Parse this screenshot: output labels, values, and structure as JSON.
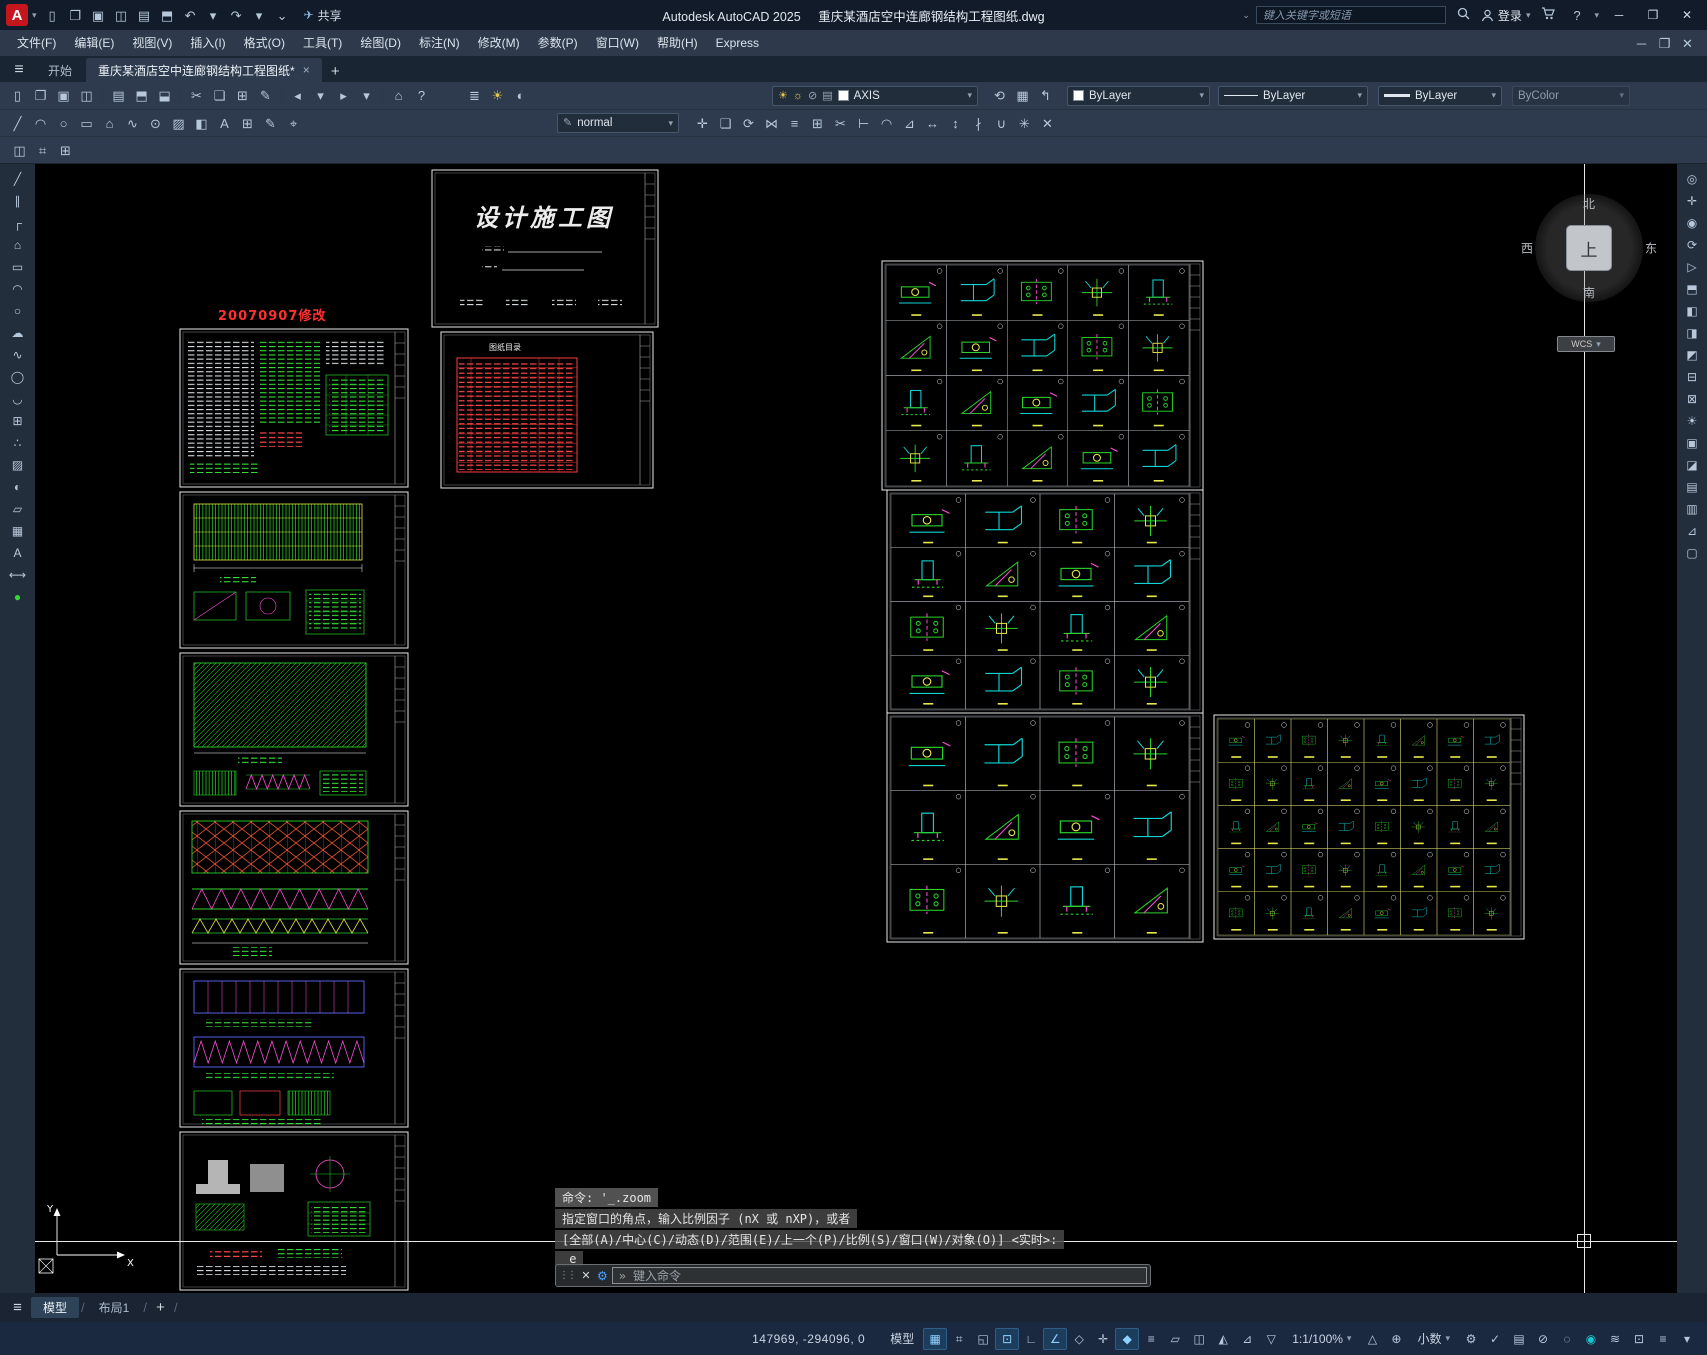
{
  "titlebar": {
    "app": "Autodesk AutoCAD 2025",
    "doc": "重庆某酒店空中连廊钢结构工程图纸.dwg",
    "share": "共享",
    "search_placeholder": "键入关键字或短语",
    "login": "登录"
  },
  "menu": [
    "文件(F)",
    "编辑(E)",
    "视图(V)",
    "插入(I)",
    "格式(O)",
    "工具(T)",
    "绘图(D)",
    "标注(N)",
    "修改(M)",
    "参数(P)",
    "窗口(W)",
    "帮助(H)",
    "Express"
  ],
  "doc_tabs": {
    "start": "开始",
    "drawing": "重庆某酒店空中连廊钢结构工程图纸*"
  },
  "ribbon": {
    "layer": "AXIS",
    "color": "ByLayer",
    "linetype": "ByLayer",
    "lineweight": "ByLayer",
    "plotstyle": "ByColor",
    "textstyle": "normal"
  },
  "canvas": {
    "revision_note": "20070907修改",
    "cover_title": "设计施工图",
    "index_title": "图纸目录"
  },
  "viewcube": {
    "n": "北",
    "s": "南",
    "e": "东",
    "w": "西",
    "top": "上",
    "wcs": "WCS"
  },
  "command": {
    "l1": "命令: '_.zoom",
    "l2": "指定窗口的角点，输入比例因子 (nX 或 nXP)，或者",
    "l3": "[全部(A)/中心(C)/动态(D)/范围(E)/上一个(P)/比例(S)/窗口(W)/对象(O)] <实时>:",
    "l4": "_e",
    "placeholder": "键入命令"
  },
  "layout_tabs": {
    "model": "模型",
    "layout1": "布局1"
  },
  "statusbar": {
    "coords": "147969, -294096, 0",
    "model": "模型",
    "scale": "1:1/100%",
    "units": "小数"
  },
  "colors": {
    "accent": "#4da3ff",
    "cad_green": "#27d227",
    "cad_cyan": "#0fd3d3",
    "cad_magenta": "#ff4fd8",
    "cad_red": "#ff3b3b",
    "cad_yellow": "#e8e84a"
  },
  "icons": {
    "qat": [
      {
        "n": "qnew",
        "g": "▯"
      },
      {
        "n": "open-file",
        "g": "❐"
      },
      {
        "n": "save-file",
        "g": "▣"
      },
      {
        "n": "save-as",
        "g": "◫"
      },
      {
        "n": "plot",
        "g": "▤"
      },
      {
        "n": "print-preview",
        "g": "⬒"
      },
      {
        "n": "undo",
        "g": "↶"
      },
      {
        "n": "undo-menu",
        "g": "▾"
      },
      {
        "n": "redo",
        "g": "↷"
      },
      {
        "n": "redo-menu",
        "g": "▾"
      },
      {
        "n": "customize-qat",
        "g": "⌄"
      }
    ],
    "mwin": [
      {
        "n": "doc-minimize",
        "g": "─"
      },
      {
        "n": "doc-restore",
        "g": "❐"
      },
      {
        "n": "doc-close",
        "g": "✕"
      }
    ],
    "r1a": [
      {
        "n": "qnew",
        "g": "▯"
      },
      {
        "n": "open-file",
        "g": "❐"
      },
      {
        "n": "save-file",
        "g": "▣"
      },
      {
        "n": "save-all",
        "g": "◫"
      },
      {
        "n": "sep"
      },
      {
        "n": "plot",
        "g": "▤"
      },
      {
        "n": "plot-preview",
        "g": "⬒"
      },
      {
        "n": "publish",
        "g": "⬓"
      },
      {
        "n": "sep"
      },
      {
        "n": "cut-clip",
        "g": "✂"
      },
      {
        "n": "copy-clip",
        "g": "❏"
      },
      {
        "n": "paste-clip",
        "g": "⊞"
      },
      {
        "n": "match-properties",
        "g": "✎"
      },
      {
        "n": "sep"
      },
      {
        "n": "undo-large",
        "g": "◂"
      },
      {
        "n": "undo-caret",
        "g": "▾"
      },
      {
        "n": "redo-large",
        "g": "▸"
      },
      {
        "n": "redo-caret",
        "g": "▾"
      },
      {
        "n": "sep"
      },
      {
        "n": "zoom-previous",
        "g": "⌂"
      },
      {
        "n": "help",
        "g": "?"
      }
    ],
    "r1b": [
      {
        "n": "layer-properties",
        "g": "≣"
      },
      {
        "n": "layer-off",
        "g": "☀",
        "c": "gold"
      },
      {
        "n": "layer-isolate",
        "g": "◐"
      }
    ],
    "r1c": [
      {
        "n": "layer-previous",
        "g": "⟲"
      },
      {
        "n": "layer-states",
        "g": "▦"
      },
      {
        "n": "layer-match",
        "g": "↰"
      }
    ],
    "r2a": [
      {
        "n": "line",
        "g": "╱"
      },
      {
        "n": "arc",
        "g": "◠"
      },
      {
        "n": "circle",
        "g": "○"
      },
      {
        "n": "rectangle",
        "g": "▭"
      },
      {
        "n": "polygon",
        "g": "⌂"
      },
      {
        "n": "spline",
        "g": "∿"
      },
      {
        "n": "donut",
        "g": "⊙"
      },
      {
        "n": "hatch",
        "g": "▨"
      },
      {
        "n": "gradient",
        "g": "◧"
      },
      {
        "n": "text",
        "g": "A"
      },
      {
        "n": "table",
        "g": "⊞"
      },
      {
        "n": "edit-text",
        "g": "✎"
      },
      {
        "n": "point",
        "g": "⌖"
      }
    ],
    "r2b": [
      {
        "n": "move",
        "g": "✛"
      },
      {
        "n": "copy",
        "g": "❏"
      },
      {
        "n": "rotate",
        "g": "⟳"
      },
      {
        "n": "mirror",
        "g": "⋈"
      },
      {
        "n": "offset",
        "g": "≡"
      },
      {
        "n": "array",
        "g": "⊞"
      },
      {
        "n": "trim",
        "g": "✂"
      },
      {
        "n": "extend",
        "g": "⊢"
      },
      {
        "n": "fillet",
        "g": "◠"
      },
      {
        "n": "chamfer",
        "g": "⊿"
      },
      {
        "n": "stretch",
        "g": "↔"
      },
      {
        "n": "scale",
        "g": "↕"
      },
      {
        "n": "break",
        "g": "∤"
      },
      {
        "n": "join",
        "g": "∪"
      },
      {
        "n": "explode",
        "g": "✳"
      },
      {
        "n": "erase",
        "g": "✕"
      }
    ],
    "r3": [
      {
        "n": "drawing-compare",
        "g": "◫"
      },
      {
        "n": "measure",
        "g": "⌗"
      },
      {
        "n": "count",
        "g": "⊞"
      }
    ],
    "left": [
      {
        "n": "line",
        "g": "╱"
      },
      {
        "n": "construction-line",
        "g": "∥"
      },
      {
        "n": "polyline",
        "g": "┌"
      },
      {
        "n": "polygon",
        "g": "⌂"
      },
      {
        "n": "rectangle",
        "g": "▭"
      },
      {
        "n": "arc",
        "g": "◠"
      },
      {
        "n": "circle",
        "g": "○"
      },
      {
        "n": "revision-cloud",
        "g": "☁"
      },
      {
        "n": "spline",
        "g": "∿"
      },
      {
        "n": "ellipse",
        "g": "◯"
      },
      {
        "n": "ellipse-arc",
        "g": "◡"
      },
      {
        "n": "insert-block",
        "g": "⊞"
      },
      {
        "n": "point",
        "g": "∴"
      },
      {
        "n": "hatch",
        "g": "▨"
      },
      {
        "n": "gradient",
        "g": "◐"
      },
      {
        "n": "region",
        "g": "▱"
      },
      {
        "n": "table",
        "g": "▦"
      },
      {
        "n": "multiline-text",
        "g": "A"
      },
      {
        "n": "dimension",
        "g": "⟷"
      },
      {
        "n": "layer-color",
        "g": "●",
        "c": "green"
      }
    ],
    "right": [
      {
        "n": "navigation-wheel",
        "g": "◎"
      },
      {
        "n": "pan",
        "g": "✛"
      },
      {
        "n": "zoom-extents",
        "g": "◉"
      },
      {
        "n": "orbit",
        "g": "⟳"
      },
      {
        "n": "show-motion",
        "g": "▷"
      },
      {
        "n": "view-top",
        "g": "⬒"
      },
      {
        "n": "view-front",
        "g": "◧"
      },
      {
        "n": "view-right",
        "g": "◨"
      },
      {
        "n": "view-iso",
        "g": "◩"
      },
      {
        "n": "section-plane",
        "g": "⊟"
      },
      {
        "n": "camera",
        "g": "⊠"
      },
      {
        "n": "sun-properties",
        "g": "☀"
      },
      {
        "n": "materials",
        "g": "▣"
      },
      {
        "n": "visual-styles",
        "g": "◪"
      },
      {
        "n": "named-views",
        "g": "▤"
      },
      {
        "n": "render-region",
        "g": "▥"
      },
      {
        "n": "ucs-toggle",
        "g": "⊿"
      },
      {
        "n": "viewport-controls",
        "g": "▢"
      }
    ],
    "sa": [
      {
        "n": "grid",
        "g": "▦",
        "a": 1
      },
      {
        "n": "snap-mode",
        "g": "⌗"
      },
      {
        "n": "infer-constraints",
        "g": "◱"
      },
      {
        "n": "dynamic-input",
        "g": "⊡",
        "a": 1
      },
      {
        "n": "ortho-mode",
        "g": "∟"
      },
      {
        "n": "polar-tracking",
        "g": "∠",
        "a": 1
      },
      {
        "n": "isometric-drafting",
        "g": "◇"
      },
      {
        "n": "object-snap-tracking",
        "g": "✛"
      },
      {
        "n": "object-snap",
        "g": "◆",
        "a": 1
      },
      {
        "n": "lineweight-display",
        "g": "≡"
      },
      {
        "n": "transparency",
        "g": "▱"
      },
      {
        "n": "selection-cycling",
        "g": "◫"
      },
      {
        "n": "3d-object-snap",
        "g": "◭"
      },
      {
        "n": "dynamic-ucs",
        "g": "⊿"
      },
      {
        "n": "selection-filter",
        "g": "▽"
      }
    ],
    "sb": [
      {
        "n": "annotation-visibility",
        "g": "△"
      },
      {
        "n": "autoscale",
        "g": "⊕"
      }
    ],
    "sc": [
      {
        "n": "workspace-switching",
        "g": "⚙"
      },
      {
        "n": "annotation-monitor",
        "g": "✓"
      },
      {
        "n": "quick-properties",
        "g": "▤"
      },
      {
        "n": "lock-ui",
        "g": "⊘"
      },
      {
        "n": "isolate-objects",
        "g": "◌"
      },
      {
        "n": "graphics-performance",
        "g": "◉",
        "c": "teal"
      },
      {
        "n": "hardware-acceleration",
        "g": "≋"
      },
      {
        "n": "clean-screen",
        "g": "⊡"
      },
      {
        "n": "customization",
        "g": "≡"
      },
      {
        "n": "status-menu",
        "g": "▾"
      }
    ]
  }
}
